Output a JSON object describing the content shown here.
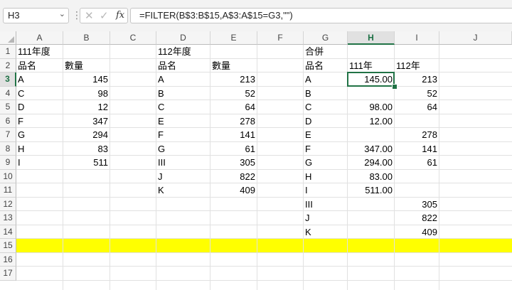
{
  "name_box": {
    "value": "H3",
    "dropdown_icon": "chevron-down-icon"
  },
  "formula_bar": {
    "fx_label": "fx",
    "cancel_icon": "close-icon",
    "enter_icon": "check-icon",
    "formula": "=FILTER(B$3:B$15,A$3:A$15=G3,\"\")"
  },
  "columns": [
    "A",
    "B",
    "C",
    "D",
    "E",
    "F",
    "G",
    "H",
    "I",
    "J"
  ],
  "rows": [
    "1",
    "2",
    "3",
    "4",
    "5",
    "6",
    "7",
    "8",
    "9",
    "10",
    "11",
    "12",
    "13",
    "14",
    "15",
    "16",
    "17"
  ],
  "active_cell": {
    "ref": "H3",
    "col": "H",
    "row": "3"
  },
  "highlight": {
    "row": "15",
    "color": "#ffff00"
  },
  "cells": [
    {
      "ref": "A1",
      "text": "111年度",
      "align": "l"
    },
    {
      "ref": "D1",
      "text": "112年度",
      "align": "l"
    },
    {
      "ref": "G1",
      "text": "合併",
      "align": "l"
    },
    {
      "ref": "A2",
      "text": "品名",
      "align": "l"
    },
    {
      "ref": "B2",
      "text": "數量",
      "align": "l"
    },
    {
      "ref": "D2",
      "text": "品名",
      "align": "l"
    },
    {
      "ref": "E2",
      "text": "數量",
      "align": "l"
    },
    {
      "ref": "G2",
      "text": "品名",
      "align": "l"
    },
    {
      "ref": "H2",
      "text": "111年",
      "align": "l"
    },
    {
      "ref": "I2",
      "text": "112年",
      "align": "l"
    },
    {
      "ref": "A3",
      "text": "A",
      "align": "l"
    },
    {
      "ref": "B3",
      "text": "145",
      "align": "r"
    },
    {
      "ref": "D3",
      "text": "A",
      "align": "l"
    },
    {
      "ref": "E3",
      "text": "213",
      "align": "r"
    },
    {
      "ref": "G3",
      "text": "A",
      "align": "l"
    },
    {
      "ref": "H3",
      "text": "145.00",
      "align": "r"
    },
    {
      "ref": "I3",
      "text": "213",
      "align": "r"
    },
    {
      "ref": "A4",
      "text": "C",
      "align": "l"
    },
    {
      "ref": "B4",
      "text": "98",
      "align": "r"
    },
    {
      "ref": "D4",
      "text": "B",
      "align": "l"
    },
    {
      "ref": "E4",
      "text": "52",
      "align": "r"
    },
    {
      "ref": "G4",
      "text": "B",
      "align": "l"
    },
    {
      "ref": "I4",
      "text": "52",
      "align": "r"
    },
    {
      "ref": "A5",
      "text": "D",
      "align": "l"
    },
    {
      "ref": "B5",
      "text": "12",
      "align": "r"
    },
    {
      "ref": "D5",
      "text": "C",
      "align": "l"
    },
    {
      "ref": "E5",
      "text": "64",
      "align": "r"
    },
    {
      "ref": "G5",
      "text": "C",
      "align": "l"
    },
    {
      "ref": "H5",
      "text": "98.00",
      "align": "r"
    },
    {
      "ref": "I5",
      "text": "64",
      "align": "r"
    },
    {
      "ref": "A6",
      "text": "F",
      "align": "l"
    },
    {
      "ref": "B6",
      "text": "347",
      "align": "r"
    },
    {
      "ref": "D6",
      "text": "E",
      "align": "l"
    },
    {
      "ref": "E6",
      "text": "278",
      "align": "r"
    },
    {
      "ref": "G6",
      "text": "D",
      "align": "l"
    },
    {
      "ref": "H6",
      "text": "12.00",
      "align": "r"
    },
    {
      "ref": "A7",
      "text": "G",
      "align": "l"
    },
    {
      "ref": "B7",
      "text": "294",
      "align": "r"
    },
    {
      "ref": "D7",
      "text": "F",
      "align": "l"
    },
    {
      "ref": "E7",
      "text": "141",
      "align": "r"
    },
    {
      "ref": "G7",
      "text": "E",
      "align": "l"
    },
    {
      "ref": "I7",
      "text": "278",
      "align": "r"
    },
    {
      "ref": "A8",
      "text": "H",
      "align": "l"
    },
    {
      "ref": "B8",
      "text": "83",
      "align": "r"
    },
    {
      "ref": "D8",
      "text": "G",
      "align": "l"
    },
    {
      "ref": "E8",
      "text": "61",
      "align": "r"
    },
    {
      "ref": "G8",
      "text": "F",
      "align": "l"
    },
    {
      "ref": "H8",
      "text": "347.00",
      "align": "r"
    },
    {
      "ref": "I8",
      "text": "141",
      "align": "r"
    },
    {
      "ref": "A9",
      "text": "I",
      "align": "l"
    },
    {
      "ref": "B9",
      "text": "511",
      "align": "r"
    },
    {
      "ref": "D9",
      "text": "III",
      "align": "l"
    },
    {
      "ref": "E9",
      "text": "305",
      "align": "r"
    },
    {
      "ref": "G9",
      "text": "G",
      "align": "l"
    },
    {
      "ref": "H9",
      "text": "294.00",
      "align": "r"
    },
    {
      "ref": "I9",
      "text": "61",
      "align": "r"
    },
    {
      "ref": "D10",
      "text": "J",
      "align": "l"
    },
    {
      "ref": "E10",
      "text": "822",
      "align": "r"
    },
    {
      "ref": "G10",
      "text": "H",
      "align": "l"
    },
    {
      "ref": "H10",
      "text": "83.00",
      "align": "r"
    },
    {
      "ref": "D11",
      "text": "K",
      "align": "l"
    },
    {
      "ref": "E11",
      "text": "409",
      "align": "r"
    },
    {
      "ref": "G11",
      "text": "I",
      "align": "l"
    },
    {
      "ref": "H11",
      "text": "511.00",
      "align": "r"
    },
    {
      "ref": "G12",
      "text": "III",
      "align": "l"
    },
    {
      "ref": "I12",
      "text": "305",
      "align": "r"
    },
    {
      "ref": "G13",
      "text": "J",
      "align": "l"
    },
    {
      "ref": "I13",
      "text": "822",
      "align": "r"
    },
    {
      "ref": "G14",
      "text": "K",
      "align": "l"
    },
    {
      "ref": "I14",
      "text": "409",
      "align": "r"
    }
  ]
}
